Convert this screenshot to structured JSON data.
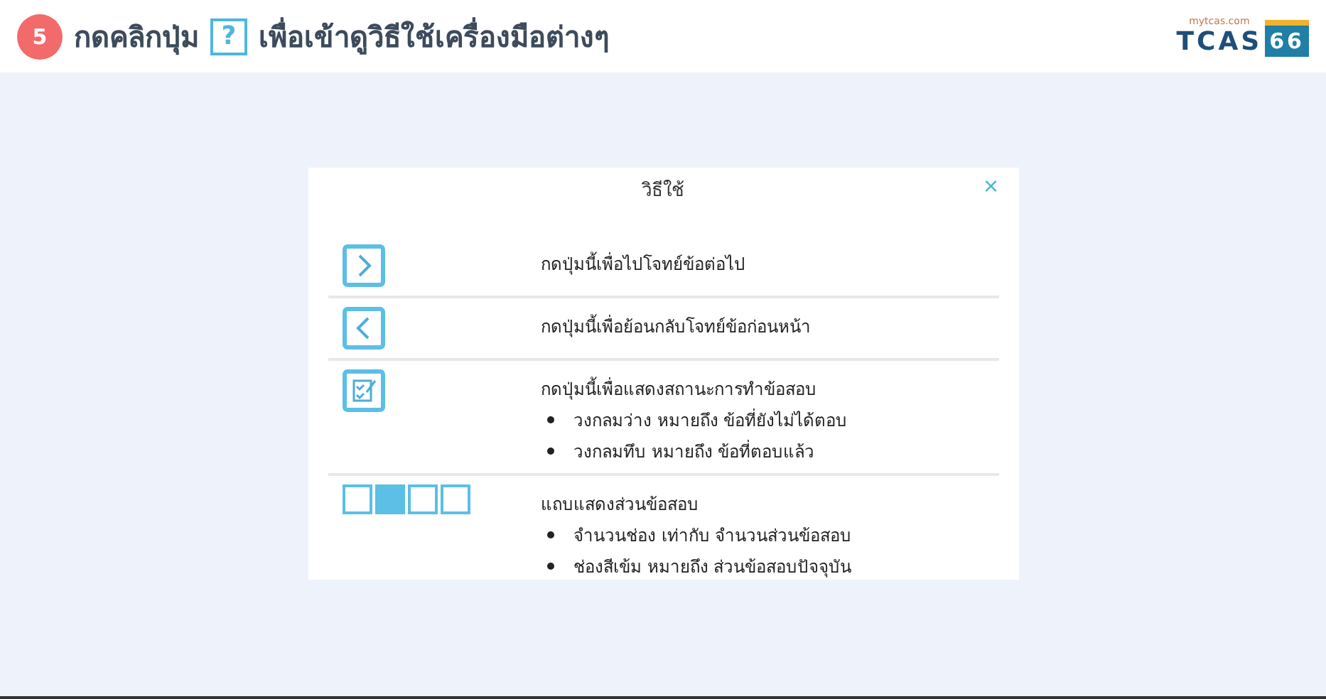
{
  "header": {
    "step": "5",
    "title_before": "กดคลิกปุ่ม",
    "help_key": "?",
    "title_after": "เพื่อเข้าดูวิธีใช้เครื่องมือต่างๆ",
    "logo": {
      "site": "mytcas.com",
      "name": "TCAS",
      "edition": "66"
    }
  },
  "dialog": {
    "title": "วิธีใช้",
    "close": "×",
    "rows": [
      {
        "kind": "next",
        "text": "กดปุ่มนี้เพื่อไปโจทย์ข้อต่อไป",
        "bullets": []
      },
      {
        "kind": "prev",
        "text": "กดปุ่มนี้เพื่อย้อนกลับโจทย์ข้อก่อนหน้า",
        "bullets": []
      },
      {
        "kind": "status",
        "text": "กดปุ่มนี้เพื่อแสดงสถานะการทำข้อสอบ",
        "bullets": [
          "วงกลมว่าง หมายถึง ข้อที่ยังไม่ได้ตอบ",
          "วงกลมทึบ หมายถึง ข้อที่ตอบแล้ว"
        ]
      },
      {
        "kind": "parts",
        "text": "แถบแสดงส่วนข้อสอบ",
        "segments": [
          {
            "selected": false
          },
          {
            "selected": true
          },
          {
            "selected": false
          },
          {
            "selected": false
          }
        ],
        "bullets": [
          "จำนวนช่อง เท่ากับ จำนวนส่วนข้อสอบ",
          "ช่องสีเข้ม หมายถึง ส่วนข้อสอบปัจจุบัน"
        ]
      }
    ]
  }
}
